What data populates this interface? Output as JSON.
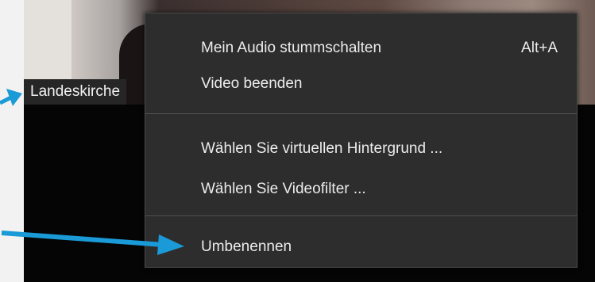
{
  "participant": {
    "name": "Landeskirche"
  },
  "context_menu": {
    "items": [
      {
        "label": "Mein Audio stummschalten",
        "shortcut": "Alt+A"
      },
      {
        "label": "Video beenden"
      },
      {
        "label": "Wählen Sie virtuellen Hintergrund ..."
      },
      {
        "label": "Wählen Sie Videofilter ..."
      },
      {
        "label": "Umbenennen"
      }
    ]
  },
  "colors": {
    "menu_background": "#2d2d2d",
    "menu_text": "#ececec",
    "annotation_arrow": "#1a9ad6"
  }
}
